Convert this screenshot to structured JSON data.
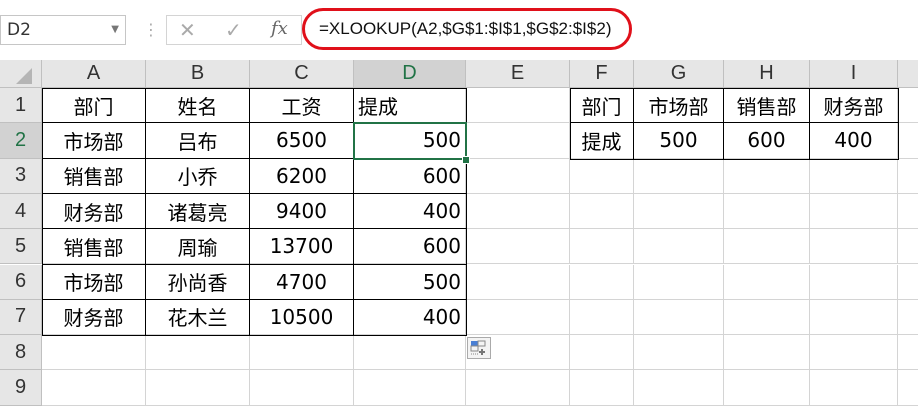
{
  "name_box": "D2",
  "formula": "=XLOOKUP(A2,$G$1:$I$1,$G$2:$I$2)",
  "fx_label": "fx",
  "cancel_glyph": "✕",
  "enter_glyph": "✓",
  "columns": [
    "A",
    "B",
    "C",
    "D",
    "E",
    "F",
    "G",
    "H",
    "I"
  ],
  "rows": [
    "1",
    "2",
    "3",
    "4",
    "5",
    "6",
    "7",
    "8",
    "9"
  ],
  "selected_cell": "D2",
  "accent": "#217346",
  "cells": [
    [
      "部门",
      "姓名",
      "工资",
      "提成",
      "",
      "部门",
      "市场部",
      "销售部",
      "财务部"
    ],
    [
      "市场部",
      "吕布",
      "6500",
      "500",
      "",
      "提成",
      "500",
      "600",
      "400"
    ],
    [
      "销售部",
      "小乔",
      "6200",
      "600",
      "",
      "",
      "",
      "",
      ""
    ],
    [
      "财务部",
      "诸葛亮",
      "9400",
      "400",
      "",
      "",
      "",
      "",
      ""
    ],
    [
      "销售部",
      "周瑜",
      "13700",
      "600",
      "",
      "",
      "",
      "",
      ""
    ],
    [
      "市场部",
      "孙尚香",
      "4700",
      "500",
      "",
      "",
      "",
      "",
      ""
    ],
    [
      "财务部",
      "花木兰",
      "10500",
      "400",
      "",
      "",
      "",
      "",
      ""
    ],
    [
      "",
      "",
      "",
      "",
      "",
      "",
      "",
      "",
      ""
    ],
    [
      "",
      "",
      "",
      "",
      "",
      "",
      "",
      "",
      ""
    ]
  ]
}
